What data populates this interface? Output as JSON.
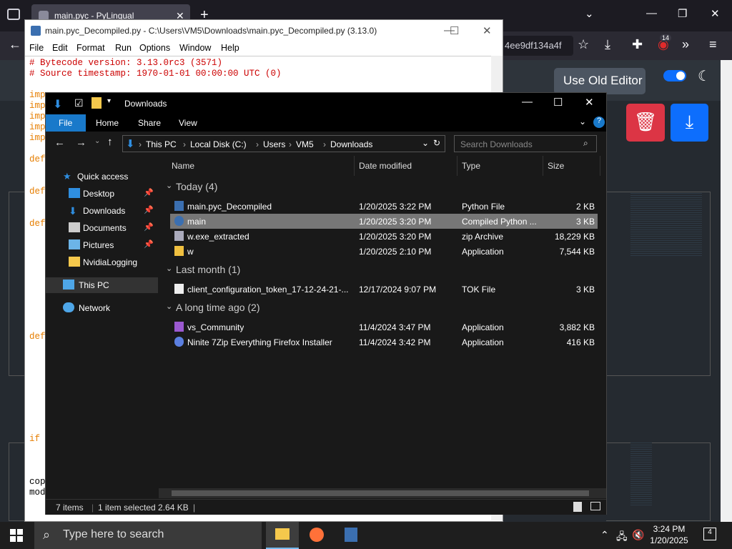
{
  "browser": {
    "tab_title": "main.pyc - PyLingual",
    "url_fragment": "4ee9df134a4f",
    "badge_count": "14"
  },
  "page": {
    "old_editor_label": "Use Old Editor"
  },
  "idle": {
    "title": "main.pyc_Decompiled.py - C:\\Users\\VM5\\Downloads\\main.pyc_Decompiled.py (3.13.0)",
    "menu": [
      "File",
      "Edit",
      "Format",
      "Run",
      "Options",
      "Window",
      "Help"
    ],
    "line1": "# Bytecode version: 3.13.0rc3 (3571)",
    "line2": "# Source timestamp: 1970-01-01 00:00:00 UTC (0)",
    "frag_imp": "imp",
    "frag_def": "def",
    "frag_if": "if",
    "frag_cop": "cop",
    "frag_mod": "mod"
  },
  "explorer": {
    "title": "Downloads",
    "ribbon": {
      "file": "File",
      "home": "Home",
      "share": "Share",
      "view": "View"
    },
    "breadcrumb": [
      "This PC",
      "Local Disk (C:)",
      "Users",
      "VM5",
      "Downloads"
    ],
    "search_placeholder": "Search Downloads",
    "nav": {
      "quick_access": "Quick access",
      "desktop": "Desktop",
      "downloads": "Downloads",
      "documents": "Documents",
      "pictures": "Pictures",
      "nvidia": "NvidiaLogging",
      "this_pc": "This PC",
      "network": "Network"
    },
    "columns": {
      "name": "Name",
      "date": "Date modified",
      "type": "Type",
      "size": "Size"
    },
    "groups": {
      "today": "Today (4)",
      "last_month": "Last month (1)",
      "long_ago": "A long time ago (2)"
    },
    "files": [
      {
        "name": "main.pyc_Decompiled",
        "date": "1/20/2025 3:22 PM",
        "type": "Python File",
        "size": "2 KB"
      },
      {
        "name": "main",
        "date": "1/20/2025 3:20 PM",
        "type": "Compiled Python ...",
        "size": "3 KB"
      },
      {
        "name": "w.exe_extracted",
        "date": "1/20/2025 3:20 PM",
        "type": "zip Archive",
        "size": "18,229 KB"
      },
      {
        "name": "w",
        "date": "1/20/2025 2:10 PM",
        "type": "Application",
        "size": "7,544 KB"
      },
      {
        "name": "client_configuration_token_17-12-24-21-...",
        "date": "12/17/2024 9:07 PM",
        "type": "TOK File",
        "size": "3 KB"
      },
      {
        "name": "vs_Community",
        "date": "11/4/2024 3:47 PM",
        "type": "Application",
        "size": "3,882 KB"
      },
      {
        "name": "Ninite 7Zip Everything Firefox Installer",
        "date": "11/4/2024 3:42 PM",
        "type": "Application",
        "size": "416 KB"
      }
    ],
    "status": {
      "items": "7 items",
      "selected": "1 item selected  2.64 KB"
    }
  },
  "taskbar": {
    "search_placeholder": "Type here to search",
    "time": "3:24 PM",
    "date": "1/20/2025",
    "notification_count": "4"
  }
}
